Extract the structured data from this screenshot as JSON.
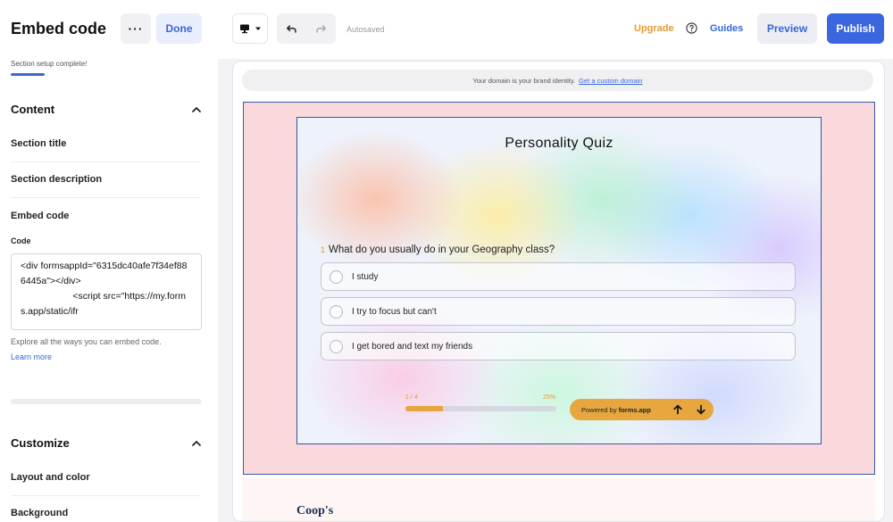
{
  "panel": {
    "title": "Embed code",
    "more_label": "···",
    "done_label": "Done",
    "setup_status": "Section setup complete!",
    "content_group": "Content",
    "fields": {
      "section_title": "Section title",
      "section_description": "Section description",
      "embed_code": "Embed code"
    },
    "code_label": "Code",
    "code_value": "<div formsappId=\"6315dc40afe7f34ef886445a\"></div>\n                    <script src=\"https://my.forms.app/static/ifr",
    "help_text": "Explore all the ways you can embed code.",
    "learn_more": "Learn more",
    "customize_group": "Customize",
    "customize_fields": {
      "layout_color": "Layout and color",
      "background": "Background"
    }
  },
  "topbar": {
    "autosaved": "Autosaved",
    "upgrade": "Upgrade",
    "guides": "Guides",
    "preview": "Preview",
    "publish": "Publish"
  },
  "canvas": {
    "domain_text": "Your domain is your brand identity.",
    "domain_link": "Get a custom domain",
    "footer_brand": "Coop's"
  },
  "quiz": {
    "title": "Personality Quiz",
    "question_number": "1",
    "question": "What do you usually do in your Geography class?",
    "options": [
      "I study",
      "I try to focus but can't",
      "I get bored and text my friends"
    ],
    "progress_left": "1 / 4",
    "progress_right": "25%",
    "progress_fraction": 0.25,
    "powered_prefix": "Powered by",
    "powered_brand": "forms.app"
  },
  "colors": {
    "accent": "#3a66e0",
    "upgrade": "#e59b36",
    "quiz_accent": "#e8a73e",
    "section_bg": "#f9d9dc"
  },
  "icons": {
    "device": "desktop-icon",
    "undo": "undo-icon",
    "redo": "redo-icon",
    "help": "help-circle-icon",
    "up": "arrow-up-icon",
    "down": "arrow-down-icon"
  }
}
